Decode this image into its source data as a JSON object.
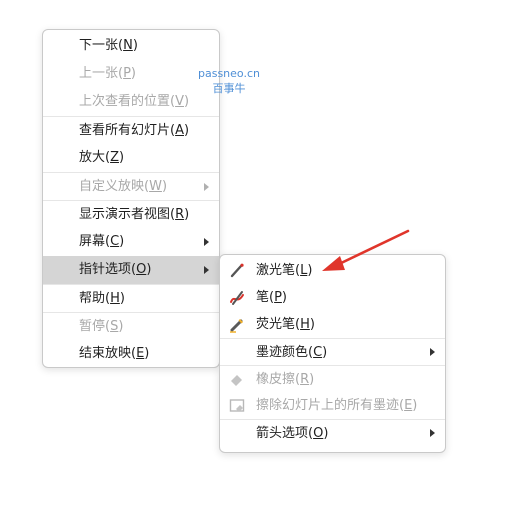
{
  "watermark": {
    "line1": "passneo.cn",
    "line2": "百事牛"
  },
  "main_menu": {
    "items": [
      {
        "label": "下一张(",
        "key": "N",
        "end": ")"
      },
      {
        "label": "上一张(",
        "key": "P",
        "end": ")"
      },
      {
        "label": "上次查看的位置(",
        "key": "V",
        "end": ")"
      },
      {
        "label": "查看所有幻灯片(",
        "key": "A",
        "end": ")"
      },
      {
        "label": "放大(",
        "key": "Z",
        "end": ")"
      },
      {
        "label": "自定义放映(",
        "key": "W",
        "end": ")"
      },
      {
        "label": "显示演示者视图(",
        "key": "R",
        "end": ")"
      },
      {
        "label": "屏幕(",
        "key": "C",
        "end": ")"
      },
      {
        "label": "指针选项(",
        "key": "O",
        "end": ")"
      },
      {
        "label": "帮助(",
        "key": "H",
        "end": ")"
      },
      {
        "label": "暂停(",
        "key": "S",
        "end": ")"
      },
      {
        "label": "结束放映(",
        "key": "E",
        "end": ")"
      }
    ]
  },
  "sub_menu": {
    "items": [
      {
        "label": "激光笔(",
        "key": "L",
        "end": ")",
        "icon": "laser-pen-icon"
      },
      {
        "label": "笔(",
        "key": "P",
        "end": ")",
        "icon": "pen-icon"
      },
      {
        "label": "荧光笔(",
        "key": "H",
        "end": ")",
        "icon": "highlighter-icon"
      },
      {
        "label": "墨迹颜色(",
        "key": "C",
        "end": ")"
      },
      {
        "label": "橡皮擦(",
        "key": "R",
        "end": ")",
        "icon": "eraser-icon"
      },
      {
        "label": "擦除幻灯片上的所有墨迹(",
        "key": "E",
        "end": ")",
        "icon": "erase-all-ink-icon"
      },
      {
        "label": "箭头选项(",
        "key": "O",
        "end": ")"
      }
    ]
  },
  "colors": {
    "highlight": "#d5d5d5",
    "disabled_text": "#a8a8a8",
    "annotation_arrow": "#e0352b",
    "watermark": "#4f8fd6"
  }
}
